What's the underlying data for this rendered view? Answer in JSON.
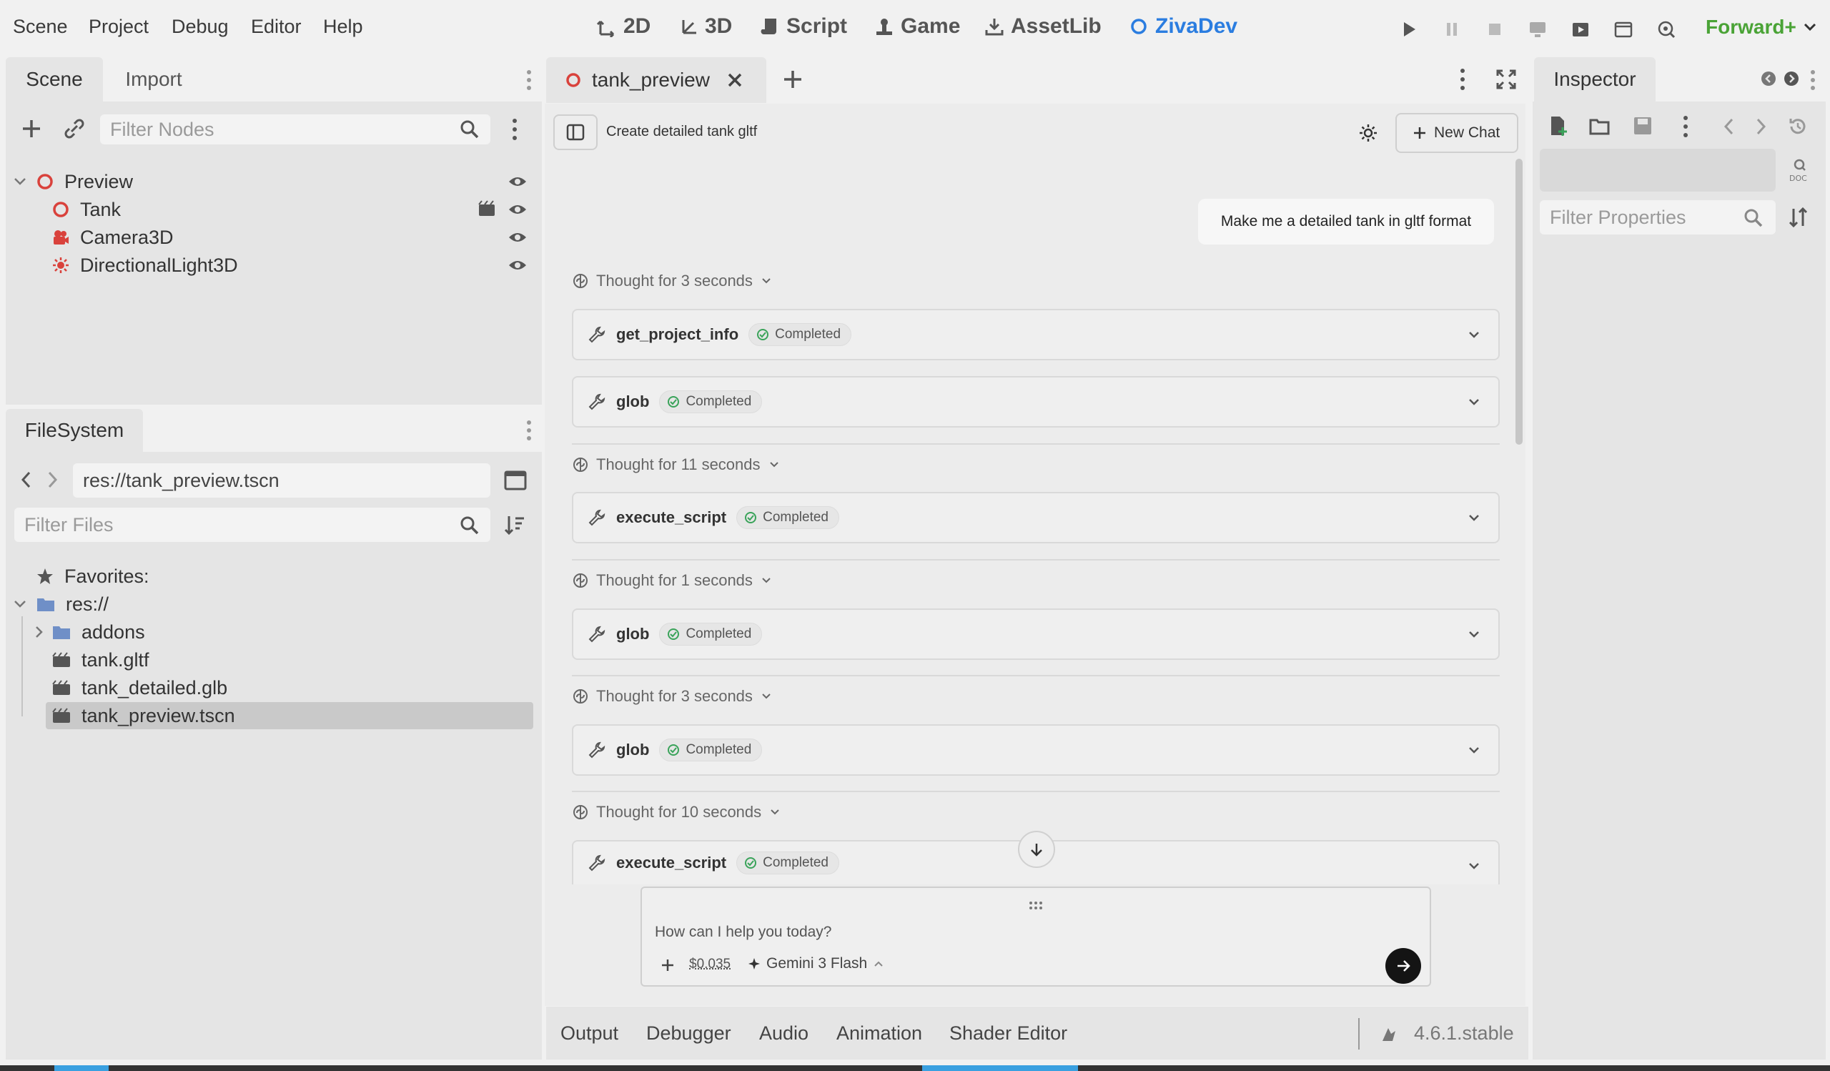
{
  "menubar": {
    "items": [
      "Scene",
      "Project",
      "Debug",
      "Editor",
      "Help"
    ],
    "workspaces": [
      {
        "label": "2D",
        "icon": "2d-icon"
      },
      {
        "label": "3D",
        "icon": "3d-icon"
      },
      {
        "label": "Script",
        "icon": "script-icon"
      },
      {
        "label": "Game",
        "icon": "game-icon"
      },
      {
        "label": "AssetLib",
        "icon": "download-icon"
      },
      {
        "label": "ZivaDev",
        "icon": "ziva-icon",
        "active": true
      }
    ],
    "renderer": "Forward+"
  },
  "scene_dock": {
    "tabs": [
      "Scene",
      "Import"
    ],
    "filter_placeholder": "Filter Nodes",
    "nodes": [
      {
        "label": "Preview",
        "icon": "node3d-icon"
      },
      {
        "label": "Tank",
        "icon": "node3d-icon"
      },
      {
        "label": "Camera3D",
        "icon": "camera-icon"
      },
      {
        "label": "DirectionalLight3D",
        "icon": "light-icon"
      }
    ]
  },
  "filesystem": {
    "tab": "FileSystem",
    "path": "res://tank_preview.tscn",
    "filter_placeholder": "Filter Files",
    "items": [
      {
        "label": "Favorites:",
        "icon": "star-icon"
      },
      {
        "label": "res://",
        "icon": "folder-icon"
      },
      {
        "label": "addons",
        "icon": "folder-icon"
      },
      {
        "label": "tank.gltf",
        "icon": "scene-file-icon"
      },
      {
        "label": "tank_detailed.glb",
        "icon": "scene-file-icon"
      },
      {
        "label": "tank_preview.tscn",
        "icon": "scene-file-icon",
        "selected": true
      }
    ]
  },
  "editor_tab": {
    "label": "tank_preview"
  },
  "chat": {
    "title": "Create detailed tank gltf",
    "new_chat_label": "New Chat",
    "user_message": "Make me a detailed tank in gltf format",
    "entries": [
      {
        "thought": "Thought for 3 seconds",
        "tools": [
          "get_project_info",
          "glob"
        ]
      },
      {
        "thought": "Thought for 11 seconds",
        "tools": [
          "execute_script"
        ]
      },
      {
        "thought": "Thought for 1 seconds",
        "tools": [
          "glob"
        ]
      },
      {
        "thought": "Thought for 3 seconds",
        "tools": [
          "glob"
        ]
      },
      {
        "thought": "Thought for 10 seconds",
        "tools": [
          "execute_script"
        ]
      }
    ],
    "completed_label": "Completed",
    "input_placeholder": "How can I help you today?",
    "cost": "$0.035",
    "model": "Gemini 3 Flash"
  },
  "inspector": {
    "tab": "Inspector",
    "filter_placeholder": "Filter Properties"
  },
  "bottom_panel": {
    "tabs": [
      "Output",
      "Debugger",
      "Audio",
      "Animation",
      "Shader Editor"
    ],
    "version": "4.6.1.stable"
  },
  "colors": {
    "accent": "#2b7de0",
    "renderer": "#4aa336",
    "node_red": "#d9423c"
  }
}
